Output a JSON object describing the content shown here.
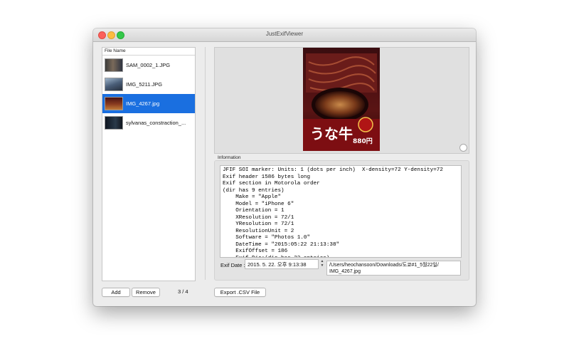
{
  "window": {
    "title": "JustExifViewer"
  },
  "file_list": {
    "header": "File Name",
    "items": [
      {
        "name": "SAM_0002_1.JPG",
        "selected": false,
        "thumb_icon": "image-thumbnail"
      },
      {
        "name": "IMG_5211.JPG",
        "selected": false,
        "thumb_icon": "image-thumbnail"
      },
      {
        "name": "IMG_4267.jpg",
        "selected": true,
        "thumb_icon": "image-thumbnail"
      },
      {
        "name": "sylvanas_constraction_...",
        "selected": false,
        "thumb_icon": "image-thumbnail"
      }
    ]
  },
  "preview": {
    "poster_text": "うな牛",
    "poster_price": "880円"
  },
  "information": {
    "label": "Information",
    "lines": [
      "JFIF SOI marker: Units: 1 (dots per inch)  X-density=72 Y-density=72",
      "Exif header 1586 bytes long",
      "Exif section in Motorola order",
      "(dir has 9 entries)",
      "    Make = \"Apple\"",
      "    Model = \"iPhone 6\"",
      "    Orientation = 1",
      "    XResolution = 72/1",
      "    YResolution = 72/1",
      "    ResolutionUnit = 2",
      "    Software = \"Photos 1.0\"",
      "    DateTime = \"2015:05:22 21:13:38\"",
      "    ExifOffset = 186",
      "    Exif Dir:(dir has 22 entries)"
    ]
  },
  "exif_date": {
    "label": "Exif Date :",
    "value": "2015.  5. 22. 오후  9:13:38"
  },
  "file_path": {
    "line1": "/Users/heochansoon/Downloads/도쿄#1_5월22일/",
    "line2": "IMG_4267.jpg"
  },
  "buttons": {
    "add": "Add",
    "remove": "Remove",
    "export": "Export .CSV File"
  },
  "counter": "3 / 4",
  "colors": {
    "selection": "#1a6fe0",
    "close": "#fc605b",
    "minimize": "#fdbc40",
    "maximize": "#34c84a"
  }
}
